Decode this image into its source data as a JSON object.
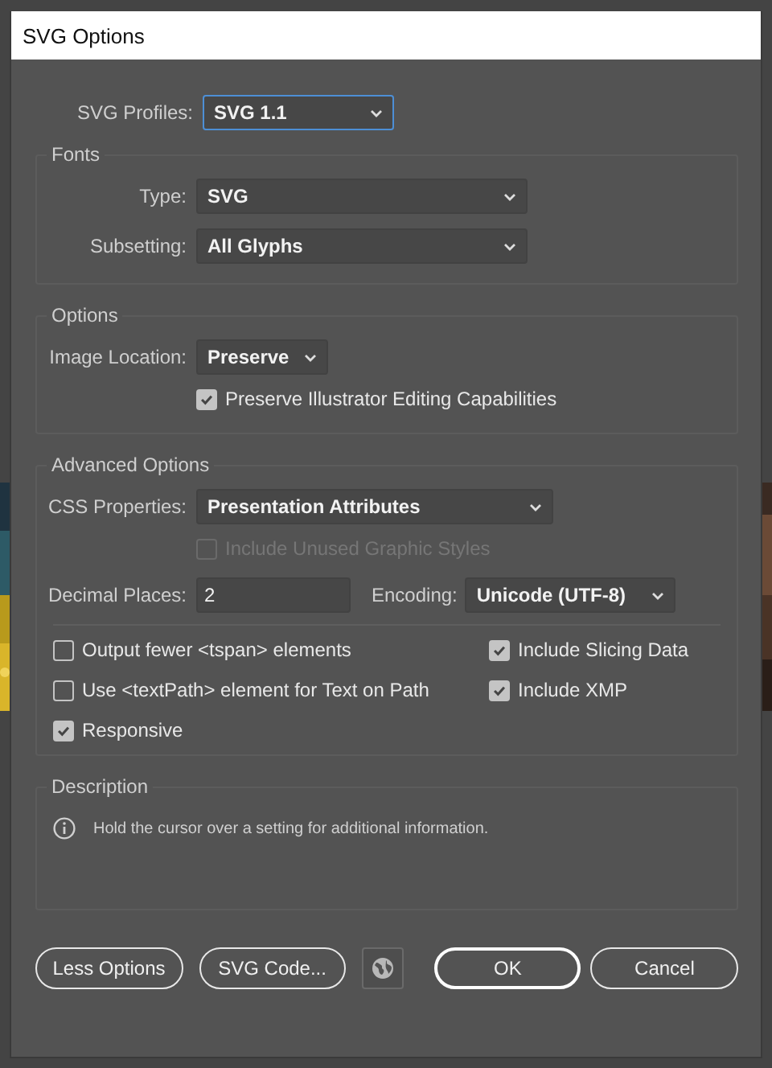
{
  "window": {
    "title": "SVG Options"
  },
  "svg_profiles": {
    "label": "SVG Profiles:",
    "value": "SVG 1.1",
    "focused": true
  },
  "fonts": {
    "title": "Fonts",
    "type": {
      "label": "Type:",
      "value": "SVG"
    },
    "subsetting": {
      "label": "Subsetting:",
      "value": "All Glyphs"
    }
  },
  "options": {
    "title": "Options",
    "image_location": {
      "label": "Image Location:",
      "value": "Preserve"
    },
    "preserve_editing": {
      "label": "Preserve Illustrator Editing Capabilities",
      "checked": true,
      "disabled": false
    }
  },
  "advanced": {
    "title": "Advanced Options",
    "css_properties": {
      "label": "CSS Properties:",
      "value": "Presentation Attributes"
    },
    "unused_styles": {
      "label": "Include Unused Graphic Styles",
      "checked": false,
      "disabled": true
    },
    "decimal_places": {
      "label": "Decimal Places:",
      "value": "2"
    },
    "encoding": {
      "label": "Encoding:",
      "value": "Unicode (UTF-8)"
    },
    "checkboxes": [
      {
        "label": "Output fewer <tspan> elements",
        "checked": false
      },
      {
        "label": "Include Slicing Data",
        "checked": true
      },
      {
        "label": "Use <textPath> element for Text on Path",
        "checked": false
      },
      {
        "label": "Include XMP",
        "checked": true
      },
      {
        "label": "Responsive",
        "checked": true
      }
    ]
  },
  "description": {
    "title": "Description",
    "text": "Hold the cursor over a setting for additional information."
  },
  "buttons": [
    {
      "kind": "pill",
      "label": "Less Options",
      "default": false
    },
    {
      "kind": "pill",
      "label": "SVG Code...",
      "default": false
    },
    {
      "kind": "globe"
    },
    {
      "kind": "pill",
      "label": "OK",
      "default": true
    },
    {
      "kind": "pill",
      "label": "Cancel",
      "default": false
    }
  ]
}
